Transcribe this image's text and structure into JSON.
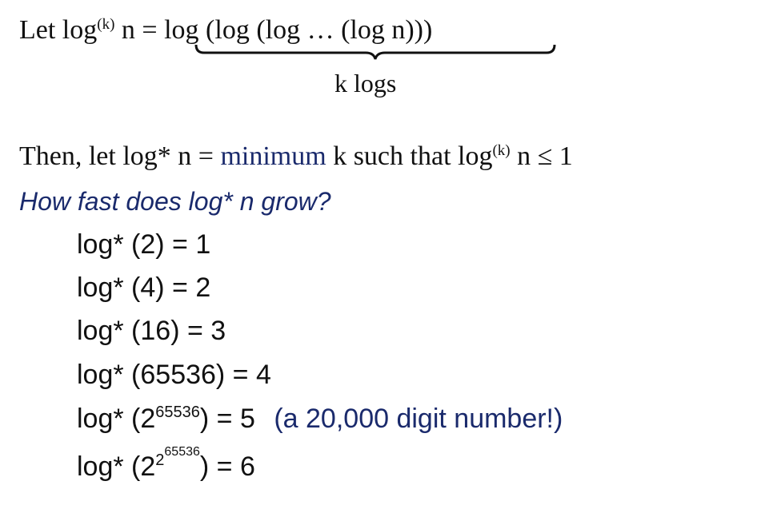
{
  "definition": {
    "prefix": "Let log",
    "sup_k": "(k)",
    "after_sup": " n = ",
    "expansion": "log (log (log … (log n)))",
    "brace_label": "k logs"
  },
  "then_line": {
    "prefix": "Then, let log* n = ",
    "highlight": "minimum",
    "middle": " k such that log",
    "sup_k": "(k)",
    "suffix": " n ≤ 1"
  },
  "question": "How fast does log* n grow?",
  "examples": [
    {
      "lhs": "log* (2) = 1"
    },
    {
      "lhs": "log* (4) = 2"
    },
    {
      "lhs": "log* (16) = 3"
    },
    {
      "lhs": "log* (65536) = 4"
    },
    {
      "prefix": "log* (2",
      "exp": "65536",
      "suffix": ") = 5",
      "note": "(a 20,000 digit number!)"
    },
    {
      "prefix": "log* (2",
      "exp1": "2",
      "exp2": "65536",
      "suffix": ") = 6"
    }
  ]
}
